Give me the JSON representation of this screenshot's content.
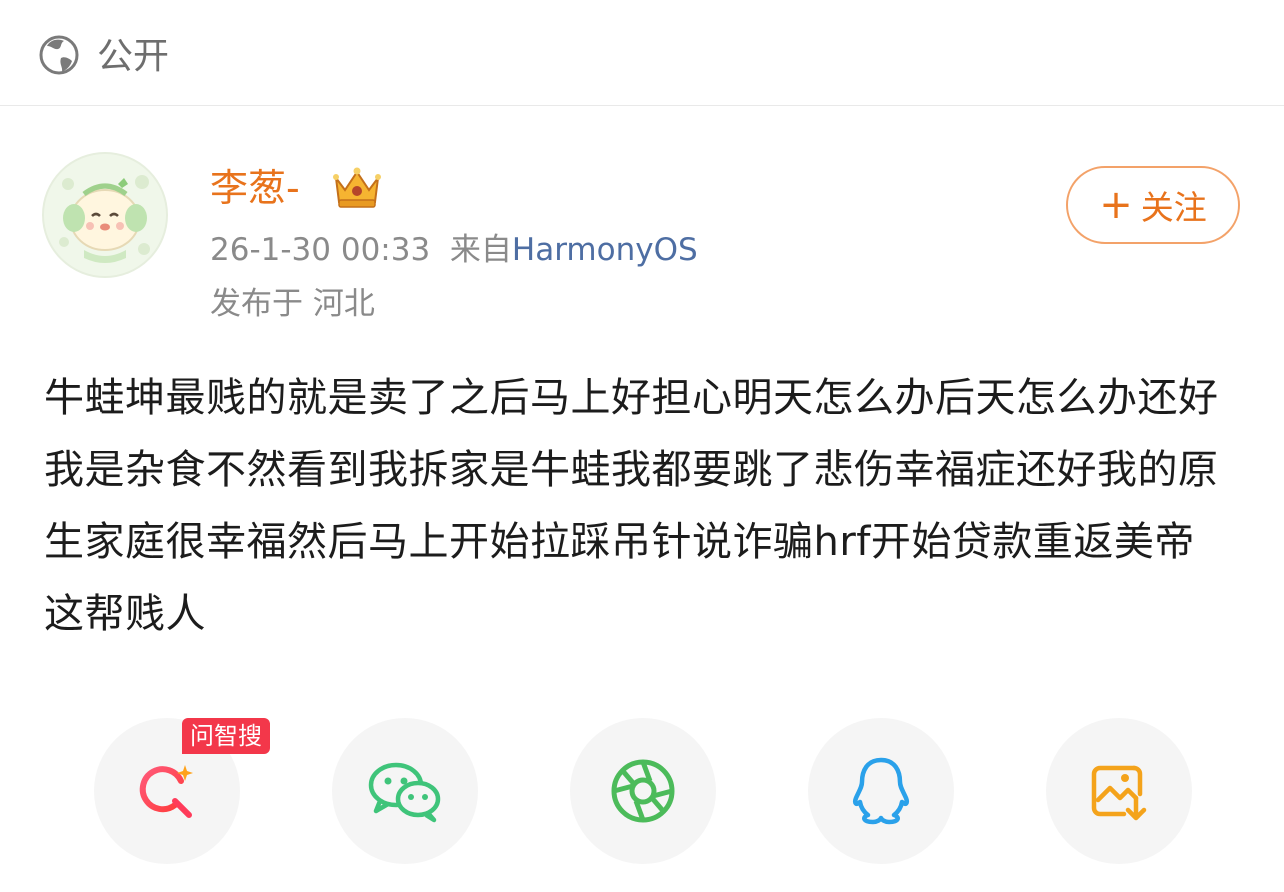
{
  "header": {
    "visibility_label": "公开",
    "visibility_icon": "globe-icon"
  },
  "post": {
    "author_name": "李葱-",
    "author_badge_icon": "crown-icon",
    "timestamp": "26-1-30 00:33",
    "source_prefix": "来自",
    "source_name": "HarmonyOS",
    "location": "发布于 河北",
    "follow_label": "关注",
    "content": "牛蛙坤最贱的就是卖了之后马上好担心明天怎么办后天怎么办还好我是杂食不然看到我拆家是牛蛙我都要跳了悲伤幸福症还好我的原生家庭很幸福然后马上开始拉踩吊针说诈骗hrf开始贷款重返美帝 这帮贱人"
  },
  "share_bar": {
    "badge_label": "问智搜",
    "items": [
      {
        "icon": "search-ai-icon"
      },
      {
        "icon": "wechat-icon"
      },
      {
        "icon": "moments-icon"
      },
      {
        "icon": "qq-icon"
      },
      {
        "icon": "save-image-icon"
      }
    ]
  },
  "colors": {
    "accent": "#e8731c",
    "source_link": "#4e6ea3",
    "muted": "#8a8a8a",
    "badge": "#f3374a"
  }
}
